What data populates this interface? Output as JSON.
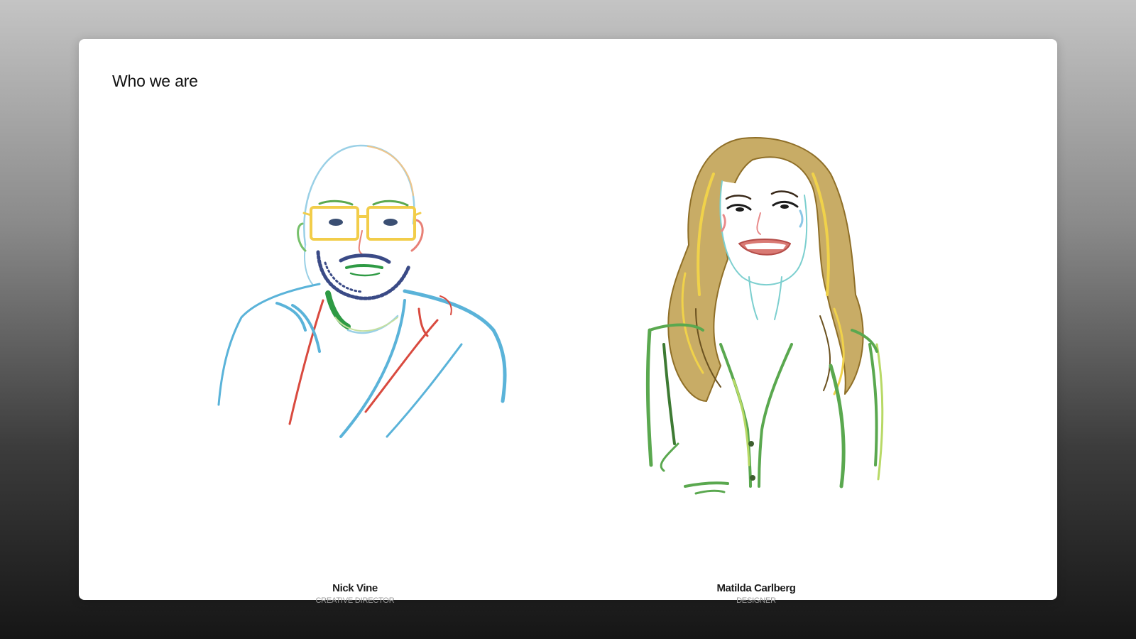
{
  "section": {
    "title": "Who we are"
  },
  "team": [
    {
      "name": "Nick Vine",
      "role": "CREATIVE DIRECTOR"
    },
    {
      "name": "Matilda Carlberg",
      "role": "DESIGNER"
    }
  ],
  "colors": {
    "background_top": "#c4c4c4",
    "background_bottom": "#161616",
    "card": "#ffffff",
    "name_text": "#1c1c1c",
    "role_text": "#9a9a9a"
  }
}
